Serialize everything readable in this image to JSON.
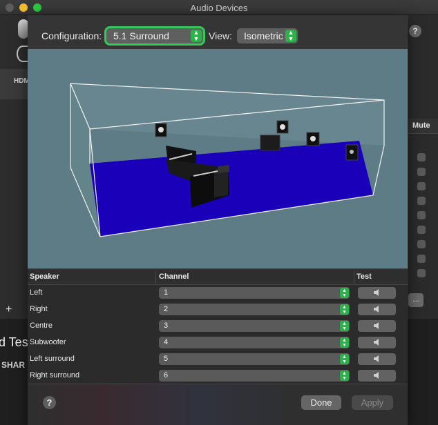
{
  "window": {
    "title": "Audio Devices"
  },
  "background": {
    "device_label": "HDM",
    "mute_header": "Mute",
    "more_button": "...",
    "add_button": "+",
    "partial_title": "d Tes",
    "partial_subtitle": "SHAR",
    "help_label": "?"
  },
  "toolbar": {
    "configuration_label": "Configuration:",
    "configuration_value": "5.1 Surround",
    "view_label": "View:",
    "view_value": "Isometric"
  },
  "table": {
    "headers": {
      "speaker": "Speaker",
      "channel": "Channel",
      "test": "Test"
    },
    "rows": [
      {
        "speaker": "Left",
        "channel": "1"
      },
      {
        "speaker": "Right",
        "channel": "2"
      },
      {
        "speaker": "Centre",
        "channel": "3"
      },
      {
        "speaker": "Subwoofer",
        "channel": "4"
      },
      {
        "speaker": "Left surround",
        "channel": "5"
      },
      {
        "speaker": "Right surround",
        "channel": "6"
      }
    ]
  },
  "footer": {
    "help_label": "?",
    "done_label": "Done",
    "apply_label": "Apply"
  },
  "colors": {
    "accent_green": "#2bb34a",
    "floor_blue": "#1a00b8",
    "room_bg": "#5d7c86"
  }
}
